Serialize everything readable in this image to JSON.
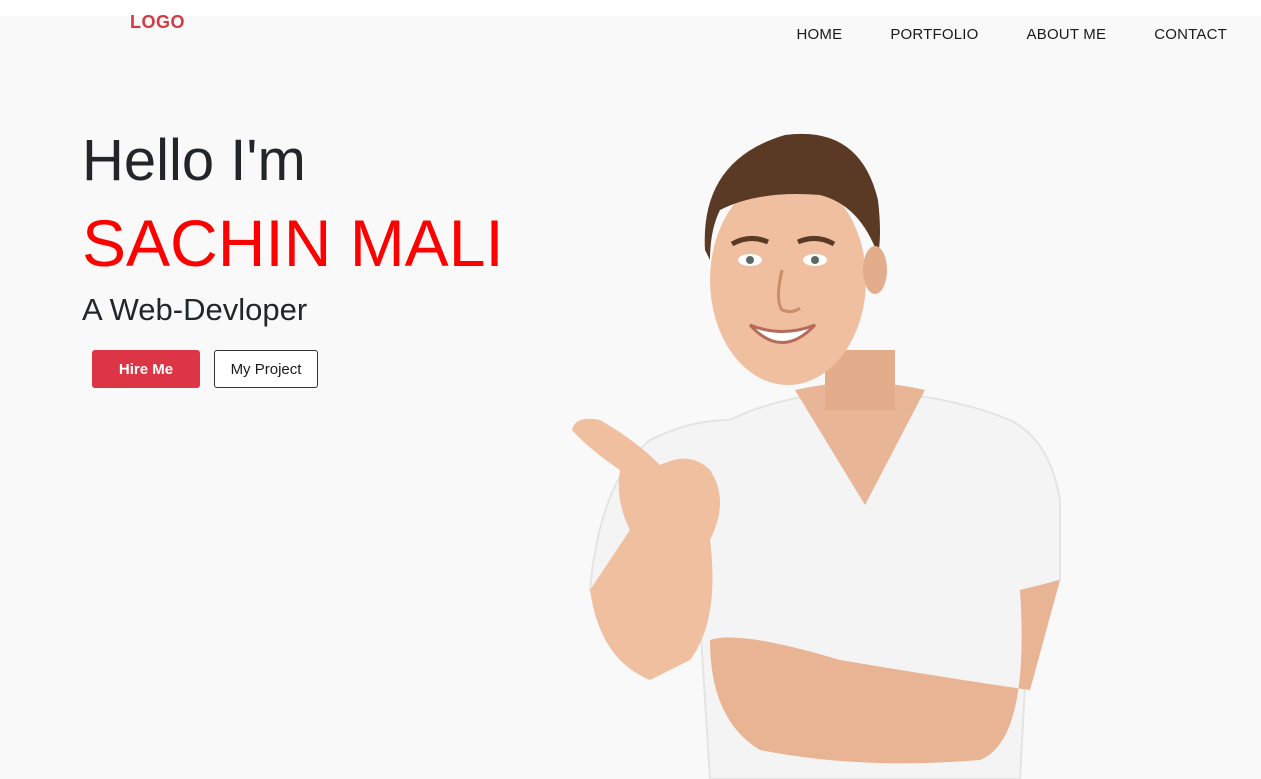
{
  "header": {
    "logo": "LOGO",
    "nav": [
      {
        "label": "HOME"
      },
      {
        "label": "PORTFOLIO"
      },
      {
        "label": "ABOUT ME"
      },
      {
        "label": "CONTACT"
      }
    ]
  },
  "hero": {
    "greeting": "Hello I'm",
    "name": "SACHIN MALI",
    "role": "A Web-Devloper",
    "buttons": {
      "hire": "Hire Me",
      "project": "My Project"
    }
  },
  "colors": {
    "accent": "#dc3545",
    "name": "#ff0000",
    "logo": "#d33a44",
    "background": "#f9f9f9"
  }
}
